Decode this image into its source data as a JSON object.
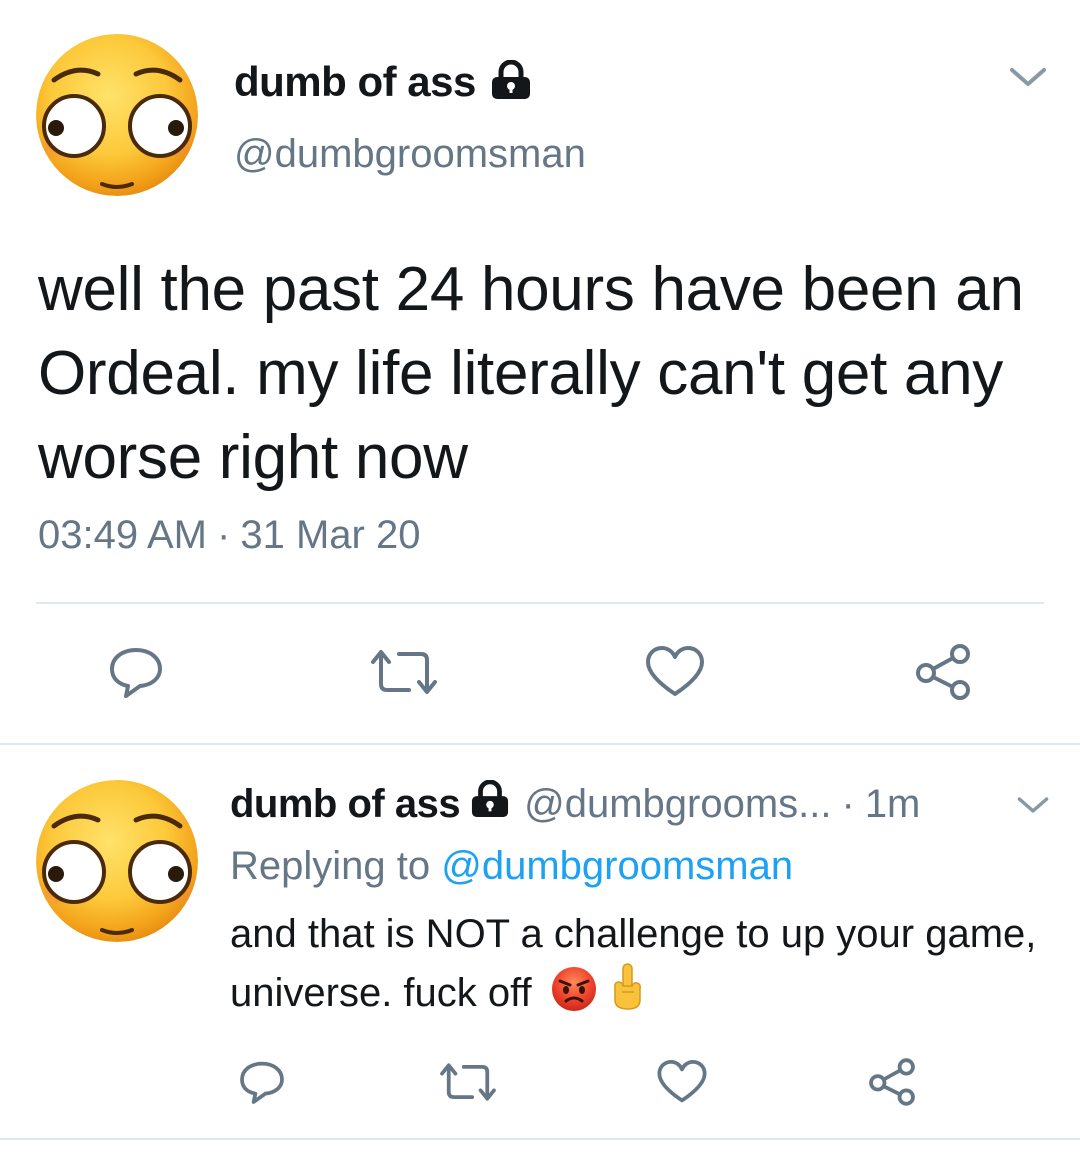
{
  "main_tweet": {
    "author_name": "dumb of ass",
    "author_handle": "@dumbgroomsman",
    "protected_icon": "lock-icon",
    "text": "well the past 24 hours have been an Ordeal. my life literally can't get any worse right now",
    "time": "03:49 AM",
    "separator": "·",
    "date": "31 Mar 20",
    "actions": [
      "reply-icon",
      "retweet-icon",
      "like-icon",
      "share-icon"
    ]
  },
  "reply_tweet": {
    "author_name": "dumb of ass",
    "author_handle": "@dumbgrooms...",
    "separator": "·",
    "time": "1m",
    "replying_to_prefix": "Replying to",
    "replying_to_handle": "@dumbgroomsman",
    "text": "and that is NOT a challenge to up your game, universe. fuck off",
    "emojis": [
      "angry-face-emoji",
      "middle-finger-emoji"
    ],
    "actions": [
      "reply-icon",
      "retweet-icon",
      "like-icon",
      "share-icon"
    ]
  },
  "colors": {
    "text_primary": "#14171a",
    "text_secondary": "#657786",
    "link": "#1da1f2",
    "divider": "#e1e8ed",
    "icon": "#657786"
  }
}
